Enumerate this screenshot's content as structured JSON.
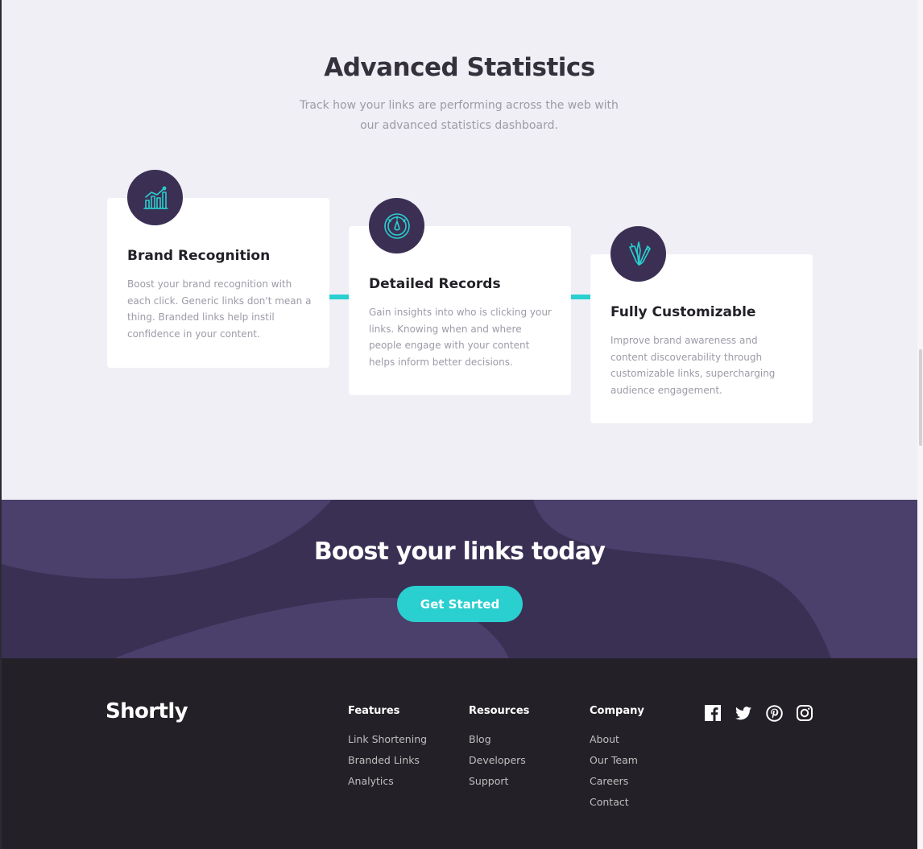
{
  "stats": {
    "title": "Advanced Statistics",
    "subtitle_line1": "Track how your links are performing across the web with",
    "subtitle_line2": "our advanced statistics dashboard."
  },
  "cards": [
    {
      "icon": "brand-recognition-icon",
      "title": "Brand Recognition",
      "lines": [
        "Boost your brand recognition with",
        "each click. Generic links don't mean a",
        "thing. Branded links help instil",
        "confidence in your content."
      ]
    },
    {
      "icon": "detailed-records-icon",
      "title": "Detailed Records",
      "lines": [
        "Gain insights into who is clicking your",
        "links. Knowing when and where",
        "people engage with your content",
        "helps inform better decisions."
      ]
    },
    {
      "icon": "fully-customizable-icon",
      "title": "Fully Customizable",
      "lines": [
        "Improve brand awareness and",
        "content discoverability through",
        "customizable links, supercharging",
        "audience engagement."
      ]
    }
  ],
  "boost": {
    "title": "Boost your links today",
    "button_label": "Get Started"
  },
  "footer": {
    "logo": "Shortly",
    "columns": [
      {
        "heading": "Features",
        "links": [
          "Link Shortening",
          "Branded Links",
          "Analytics"
        ]
      },
      {
        "heading": "Resources",
        "links": [
          "Blog",
          "Developers",
          "Support"
        ]
      },
      {
        "heading": "Company",
        "links": [
          "About",
          "Our Team",
          "Careers",
          "Contact"
        ]
      }
    ],
    "social": [
      "facebook-icon",
      "twitter-icon",
      "pinterest-icon",
      "instagram-icon"
    ]
  },
  "colors": {
    "accent_cyan": "#2acfcf",
    "dark_violet": "#3b3054",
    "very_dark_violet": "#232127",
    "page_background": "#efeff5",
    "text_gray": "#9e9aa7"
  }
}
